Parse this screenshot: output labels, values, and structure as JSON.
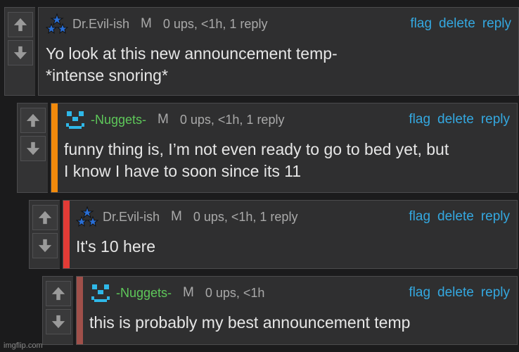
{
  "comments": [
    {
      "username": "Dr.Evil-ish",
      "role": "M",
      "meta": "0 ups, <1h, 1 reply",
      "text": "Yo look at this new announcement temp-\n*intense snoring*",
      "avatar_icon": "stars-avatar-icon",
      "stripe_color": null,
      "username_color": "#a9a9a9"
    },
    {
      "username": "-Nuggets-",
      "role": "M",
      "meta": "0 ups, <1h, 1 reply",
      "text": "funny thing is, I’m not even ready to go to bed yet, but\nI know I have to soon since its 11",
      "avatar_icon": "smiley-avatar-icon",
      "stripe_color": "#f28a0c",
      "username_color": "#5ec85a"
    },
    {
      "username": "Dr.Evil-ish",
      "role": "M",
      "meta": "0 ups, <1h, 1 reply",
      "text": "It's 10 here",
      "avatar_icon": "stars-avatar-icon",
      "stripe_color": "#e23b36",
      "username_color": "#a9a9a9"
    },
    {
      "username": "-Nuggets-",
      "role": "M",
      "meta": "0 ups, <1h",
      "text": "this is probably my best announcement temp",
      "avatar_icon": "smiley-avatar-icon",
      "stripe_color": "#a0504a",
      "username_color": "#5ec85a"
    }
  ],
  "actions": {
    "flag": "flag",
    "delete": "delete",
    "reply": "reply"
  },
  "watermark": "imgflip.com",
  "colors": {
    "background": "#1b1b1c",
    "card": "#2f2f30",
    "link": "#34a8e0",
    "green_name": "#5ec85a"
  }
}
